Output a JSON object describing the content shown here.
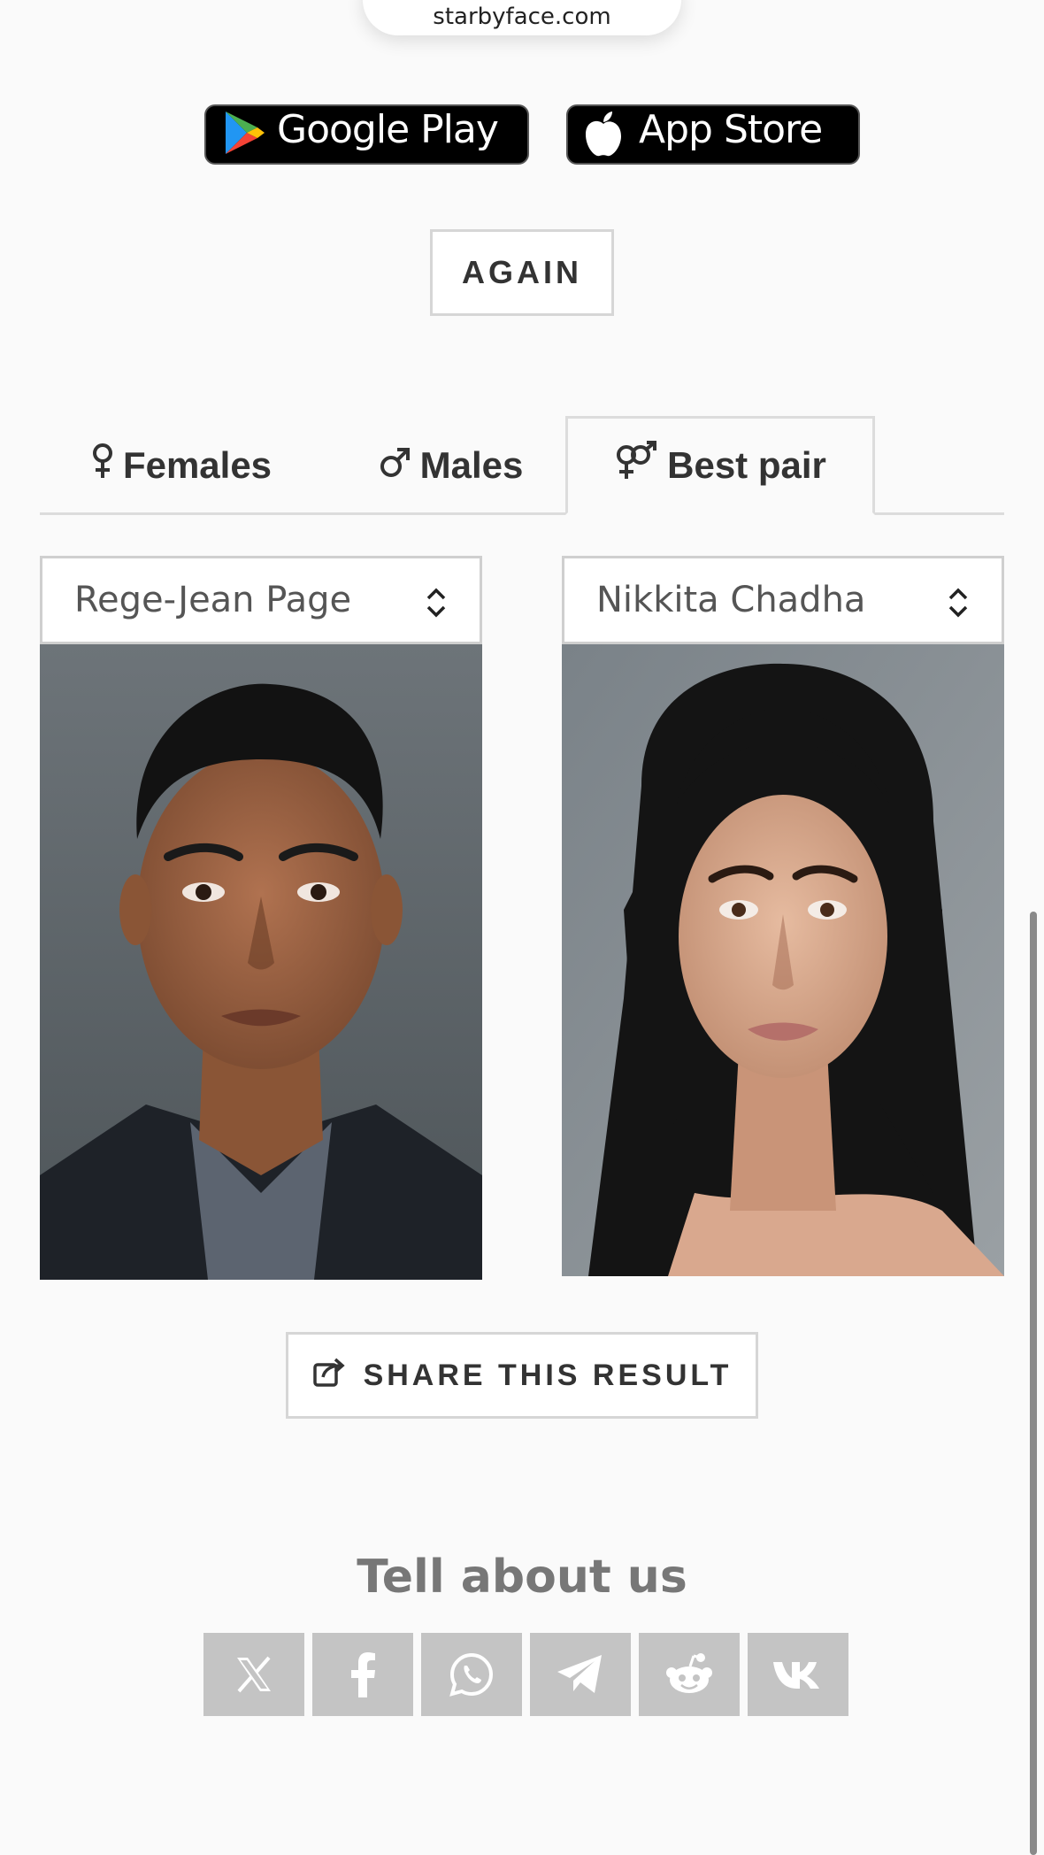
{
  "url_bar": {
    "text": "starbyface.com"
  },
  "store_badges": {
    "google": {
      "label": "Google Play",
      "icon": "google-play-icon"
    },
    "apple": {
      "label": "App Store",
      "icon": "apple-icon"
    }
  },
  "again_button": {
    "label": "AGAIN"
  },
  "tabs": [
    {
      "label": "Females",
      "icon": "female-symbol-icon"
    },
    {
      "label": "Males",
      "icon": "male-symbol-icon"
    },
    {
      "label": "Best pair",
      "icon": "pair-symbol-icon",
      "active": true
    }
  ],
  "selects": {
    "left": {
      "value": "Rege-Jean Page"
    },
    "right": {
      "value": "Nikkita Chadha"
    }
  },
  "share_button": {
    "label": "SHARE THIS RESULT",
    "icon": "share-icon"
  },
  "tell_section": {
    "title": "Tell about us",
    "social": [
      {
        "name": "x",
        "icon": "x-icon"
      },
      {
        "name": "facebook",
        "icon": "facebook-icon"
      },
      {
        "name": "whatsapp",
        "icon": "whatsapp-icon"
      },
      {
        "name": "telegram",
        "icon": "telegram-icon"
      },
      {
        "name": "reddit",
        "icon": "reddit-icon"
      },
      {
        "name": "vk",
        "icon": "vk-icon"
      }
    ]
  },
  "colors": {
    "background": "#fafafa",
    "social_button": "#c4c4c4",
    "text": "#333333",
    "muted_heading": "#777777"
  }
}
